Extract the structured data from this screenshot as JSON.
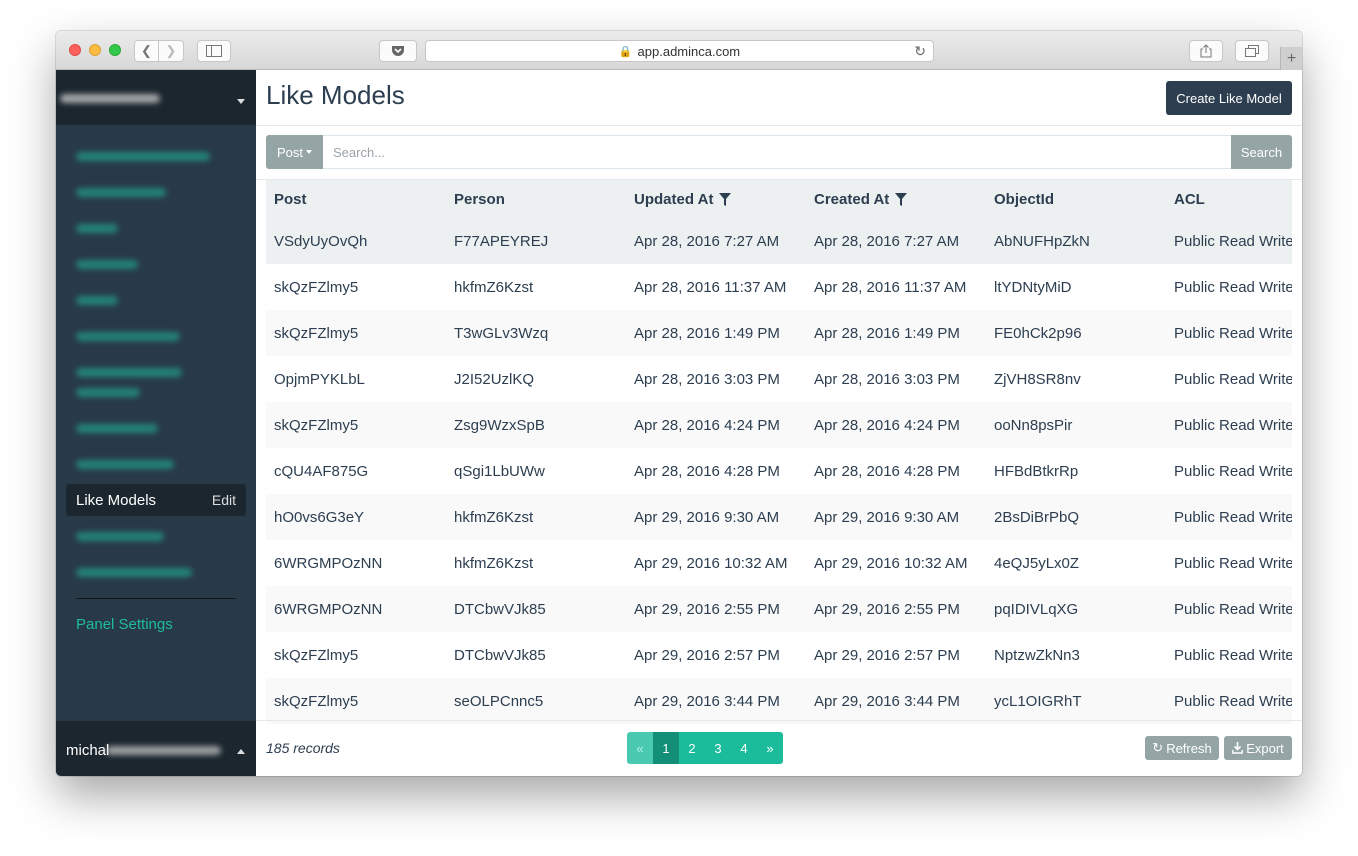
{
  "browser": {
    "url": "app.adminca.com"
  },
  "sidebar": {
    "active_item": "Like Models",
    "active_item_action": "Edit",
    "panel_settings": "Panel Settings",
    "user_name": "michal"
  },
  "main": {
    "title": "Like Models",
    "create_button": "Create Like Model",
    "filter_button": "Post",
    "search_placeholder": "Search...",
    "search_button": "Search",
    "records": "185 records",
    "refresh_button": "Refresh",
    "export_button": "Export"
  },
  "table": {
    "columns": [
      "Post",
      "Person",
      "Updated At",
      "Created At",
      "ObjectId",
      "ACL"
    ],
    "rows": [
      [
        "VSdyUyOvQh",
        "F77APEYREJ",
        "Apr 28, 2016 7:27 AM",
        "Apr 28, 2016 7:27 AM",
        "AbNUFHpZkN",
        "Public Read Write"
      ],
      [
        "skQzFZlmy5",
        "hkfmZ6Kzst",
        "Apr 28, 2016 11:37 AM",
        "Apr 28, 2016 11:37 AM",
        "ltYDNtyMiD",
        "Public Read Write"
      ],
      [
        "skQzFZlmy5",
        "T3wGLv3Wzq",
        "Apr 28, 2016 1:49 PM",
        "Apr 28, 2016 1:49 PM",
        "FE0hCk2p96",
        "Public Read Write"
      ],
      [
        "OpjmPYKLbL",
        "J2I52UzlKQ",
        "Apr 28, 2016 3:03 PM",
        "Apr 28, 2016 3:03 PM",
        "ZjVH8SR8nv",
        "Public Read Write"
      ],
      [
        "skQzFZlmy5",
        "Zsg9WzxSpB",
        "Apr 28, 2016 4:24 PM",
        "Apr 28, 2016 4:24 PM",
        "ooNn8psPir",
        "Public Read Write"
      ],
      [
        "cQU4AF875G",
        "qSgi1LbUWw",
        "Apr 28, 2016 4:28 PM",
        "Apr 28, 2016 4:28 PM",
        "HFBdBtkrRp",
        "Public Read Write"
      ],
      [
        "hO0vs6G3eY",
        "hkfmZ6Kzst",
        "Apr 29, 2016 9:30 AM",
        "Apr 29, 2016 9:30 AM",
        "2BsDiBrPbQ",
        "Public Read Write"
      ],
      [
        "6WRGMPOzNN",
        "hkfmZ6Kzst",
        "Apr 29, 2016 10:32 AM",
        "Apr 29, 2016 10:32 AM",
        "4eQJ5yLx0Z",
        "Public Read Write"
      ],
      [
        "6WRGMPOzNN",
        "DTCbwVJk85",
        "Apr 29, 2016 2:55 PM",
        "Apr 29, 2016 2:55 PM",
        "pqIDIVLqXG",
        "Public Read Write"
      ],
      [
        "skQzFZlmy5",
        "DTCbwVJk85",
        "Apr 29, 2016 2:57 PM",
        "Apr 29, 2016 2:57 PM",
        "NptzwZkNn3",
        "Public Read Write"
      ],
      [
        "skQzFZlmy5",
        "seOLPCnnc5",
        "Apr 29, 2016 3:44 PM",
        "Apr 29, 2016 3:44 PM",
        "ycL1OIGRhT",
        "Public Read Write"
      ]
    ]
  },
  "pagination": {
    "prev": "«",
    "pages": [
      "1",
      "2",
      "3",
      "4"
    ],
    "active_page": "1",
    "next": "»"
  },
  "colors": {
    "sidebar_bg": "#283a48",
    "sidebar_dark": "#1b262e",
    "accent": "#1abc9c",
    "primary_button": "#2c3e50",
    "secondary_button": "#95a5a6"
  }
}
